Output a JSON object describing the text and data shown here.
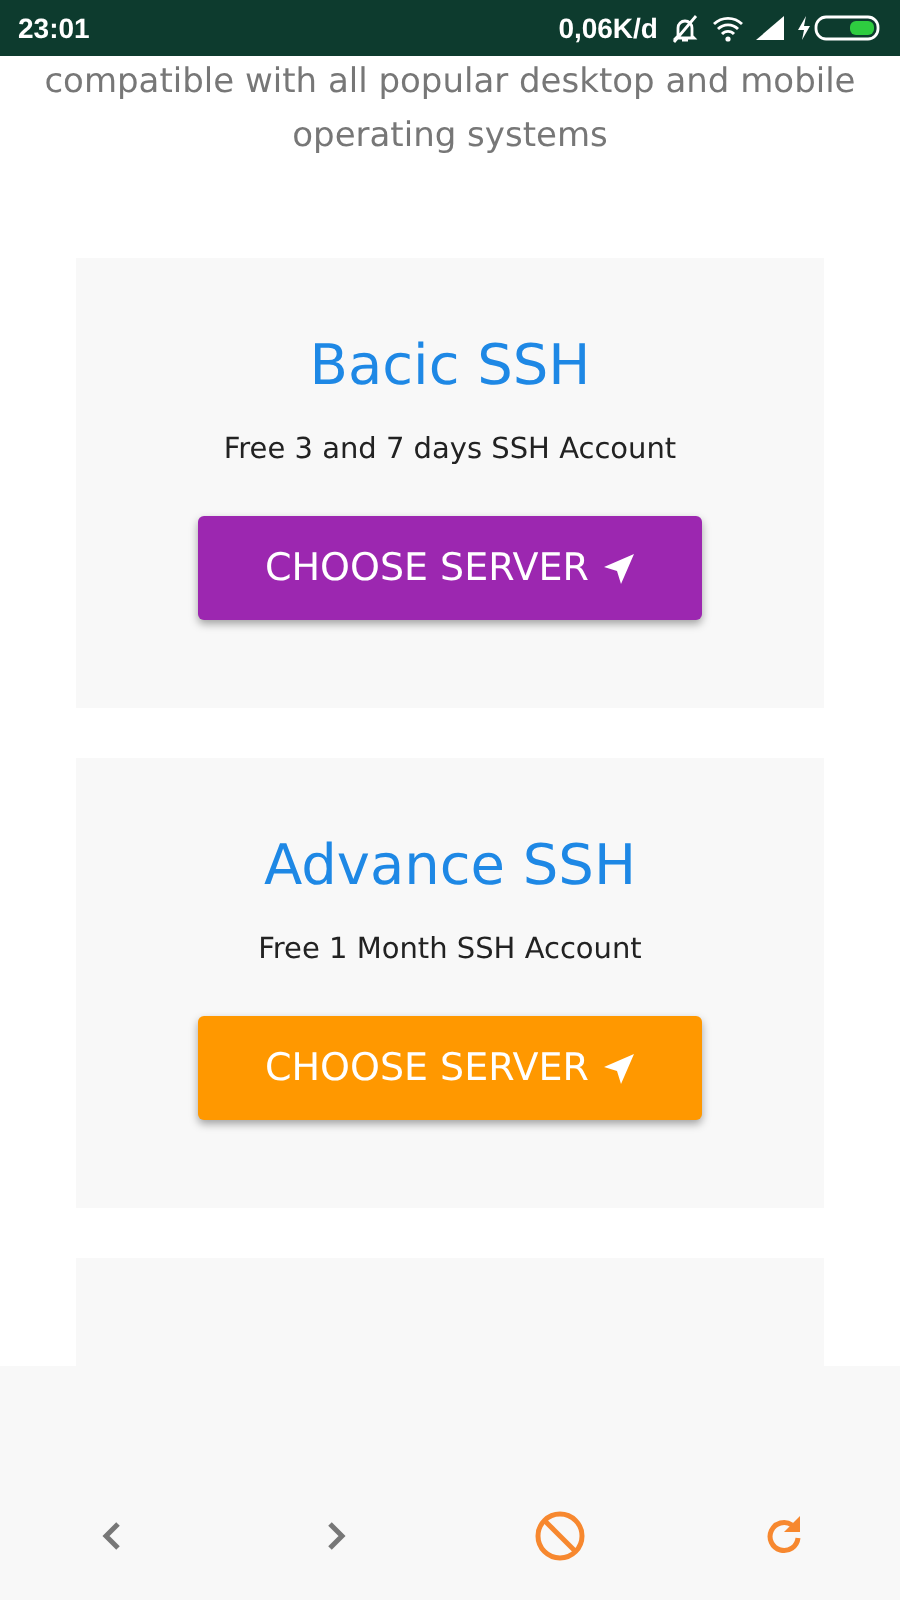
{
  "status_bar": {
    "time": "23:01",
    "speed": "0,06K/d"
  },
  "intro": "compatible with all popular desktop and mobile operating systems",
  "cards": [
    {
      "title": "Bacic SSH",
      "subtitle": "Free 3 and 7 days SSH Account",
      "button": "CHOOSE SERVER",
      "color": "#9c27b0"
    },
    {
      "title": "Advance SSH",
      "subtitle": "Free 1 Month SSH Account",
      "button": "CHOOSE SERVER",
      "color": "#ff9800"
    }
  ]
}
